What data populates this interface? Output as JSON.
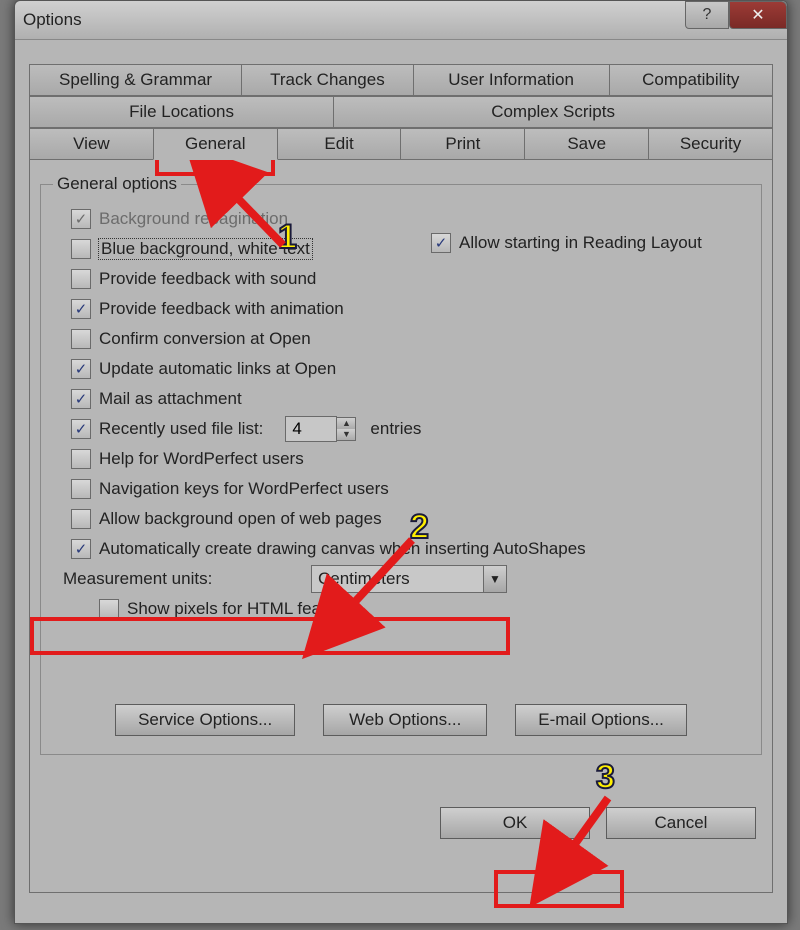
{
  "window": {
    "title": "Options"
  },
  "tabs": {
    "row1": [
      "Spelling & Grammar",
      "Track Changes",
      "User Information",
      "Compatibility"
    ],
    "row2": [
      "File Locations",
      "Complex Scripts"
    ],
    "row3": [
      "View",
      "General",
      "Edit",
      "Print",
      "Save",
      "Security"
    ],
    "active": "General"
  },
  "group": {
    "legend": "General options"
  },
  "checkboxes": {
    "bg_repag": {
      "label_html": "Background repagination",
      "checked": true,
      "disabled": true
    },
    "blue_bg": {
      "label_html": "Blue background, white text",
      "checked": false,
      "focused": true
    },
    "feedback_snd": {
      "label_html": "Provide feedback with sound",
      "checked": false
    },
    "feedback_ani": {
      "label_html": "Provide feedback with animation",
      "checked": true
    },
    "confirm_conv": {
      "label_html": "Confirm conversion at Open",
      "checked": false
    },
    "upd_links": {
      "label_html": "Update automatic links at Open",
      "checked": true
    },
    "mail_attach": {
      "label_html": "Mail as attachment",
      "checked": true
    },
    "recent_list": {
      "label_html": "Recently used file list:",
      "checked": true
    },
    "help_wp": {
      "label_html": "Help for WordPerfect users",
      "checked": false
    },
    "nav_wp": {
      "label_html": "Navigation keys for WordPerfect users",
      "checked": false
    },
    "bg_web": {
      "label_html": "Allow background open of web pages",
      "checked": false
    },
    "auto_canvas": {
      "label_html": "Automatically create drawing canvas when inserting AutoShapes",
      "checked": true
    },
    "reading_lay": {
      "label_html": "Allow starting in Reading Layout",
      "checked": true
    },
    "show_pixels": {
      "label_html": "Show pixels for HTML features",
      "checked": false
    }
  },
  "recent": {
    "value": "4",
    "suffix": "entries"
  },
  "measurement": {
    "label": "Measurement units:",
    "value": "Centimeters"
  },
  "buttons": {
    "service": "Service Options...",
    "web": "Web Options...",
    "email": "E-mail Options...",
    "ok": "OK",
    "cancel": "Cancel"
  },
  "annotations": {
    "1": "1",
    "2": "2",
    "3": "3"
  }
}
